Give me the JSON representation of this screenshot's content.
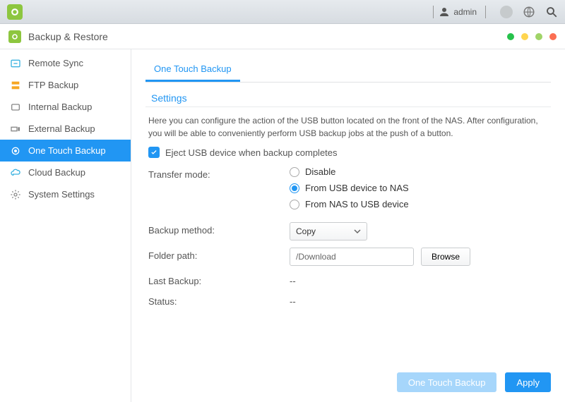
{
  "topbar": {
    "username": "admin"
  },
  "app": {
    "title": "Backup & Restore"
  },
  "sidebar": {
    "items": [
      {
        "label": "Remote Sync"
      },
      {
        "label": "FTP Backup"
      },
      {
        "label": "Internal Backup"
      },
      {
        "label": "External Backup"
      },
      {
        "label": "One Touch Backup"
      },
      {
        "label": "Cloud Backup"
      },
      {
        "label": "System Settings"
      }
    ]
  },
  "tab": {
    "label": "One Touch Backup"
  },
  "settings": {
    "title": "Settings",
    "description": "Here you can configure the action of the USB button located on the front of the NAS. After configuration, you will be able to conveniently perform USB backup jobs at the push of a button.",
    "eject_label": "Eject USB device when backup completes",
    "transfer_label": "Transfer mode:",
    "radio_disable": "Disable",
    "radio_usb_to_nas": "From USB device to NAS",
    "radio_nas_to_usb": "From NAS to USB device",
    "method_label": "Backup method:",
    "method_value": "Copy",
    "folder_label": "Folder path:",
    "folder_value": "/Download",
    "browse_label": "Browse",
    "last_backup_label": "Last Backup:",
    "last_backup_value": "--",
    "status_label": "Status:",
    "status_value": "--"
  },
  "footer": {
    "preview": "One Touch Backup",
    "apply": "Apply"
  }
}
